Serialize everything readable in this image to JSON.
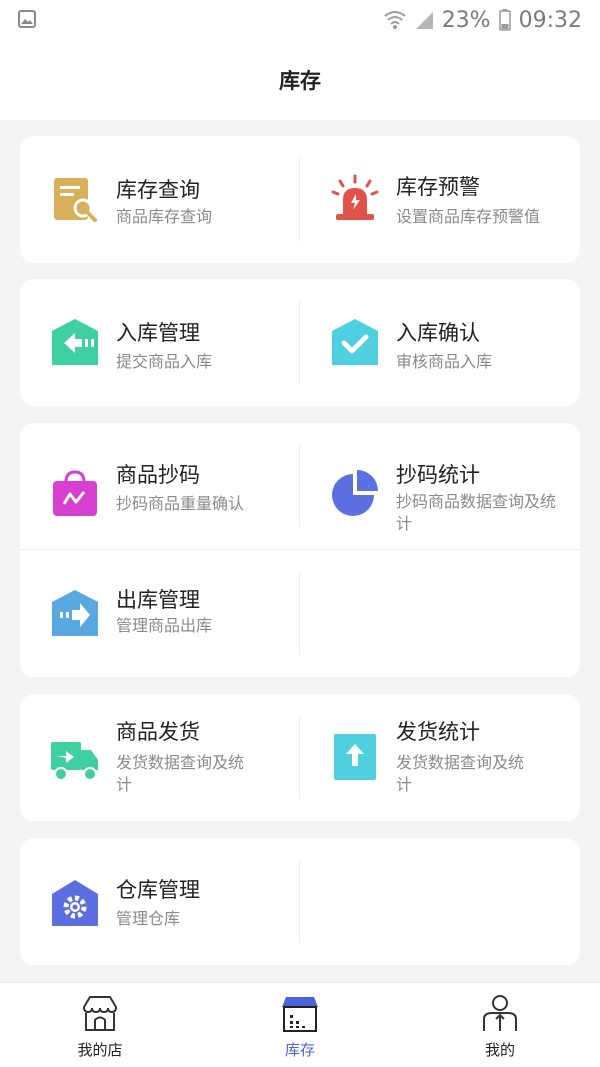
{
  "status_bar": {
    "battery": "23%",
    "time": "09:32"
  },
  "header": {
    "title": "库存"
  },
  "cards": [
    {
      "items": [
        {
          "title": "库存查询",
          "sub": "商品库存查询",
          "icon": "inventory-search-icon"
        },
        {
          "title": "库存预警",
          "sub": "设置商品库存预警值",
          "icon": "alarm-light-icon"
        }
      ]
    },
    {
      "items": [
        {
          "title": "入库管理",
          "sub": "提交商品入库",
          "icon": "inbound-arrow-icon"
        },
        {
          "title": "入库确认",
          "sub": "审核商品入库",
          "icon": "check-box-icon"
        }
      ]
    },
    {
      "items": [
        {
          "title": "商品抄码",
          "sub": "抄码商品重量确认",
          "icon": "shopping-bag-icon"
        },
        {
          "title": "抄码统计",
          "sub": "抄码商品数据查询及统计",
          "icon": "pie-chart-icon"
        },
        {
          "title": "出库管理",
          "sub": "管理商品出库",
          "icon": "outbound-arrow-icon"
        }
      ]
    },
    {
      "items": [
        {
          "title": "商品发货",
          "sub": "发货数据查询及统计",
          "icon": "delivery-truck-icon"
        },
        {
          "title": "发货统计",
          "sub": "发货数据查询及统计",
          "icon": "upload-arrow-icon"
        }
      ]
    },
    {
      "items": [
        {
          "title": "仓库管理",
          "sub": "管理仓库",
          "icon": "warehouse-gear-icon"
        }
      ]
    }
  ],
  "tabbar": {
    "items": [
      {
        "label": "我的店",
        "icon": "shop-icon",
        "active": false
      },
      {
        "label": "库存",
        "icon": "inventory-store-icon",
        "active": true
      },
      {
        "label": "我的",
        "icon": "person-icon",
        "active": false
      }
    ]
  },
  "colors": {
    "accent": "#4a63d9",
    "search": "#d9b05a",
    "alarm": "#e0524a",
    "green": "#3ed0a0",
    "teal": "#4fd0e0",
    "magenta": "#d63fd0",
    "indigo": "#5b6fe0",
    "blue": "#5aa8e0"
  }
}
